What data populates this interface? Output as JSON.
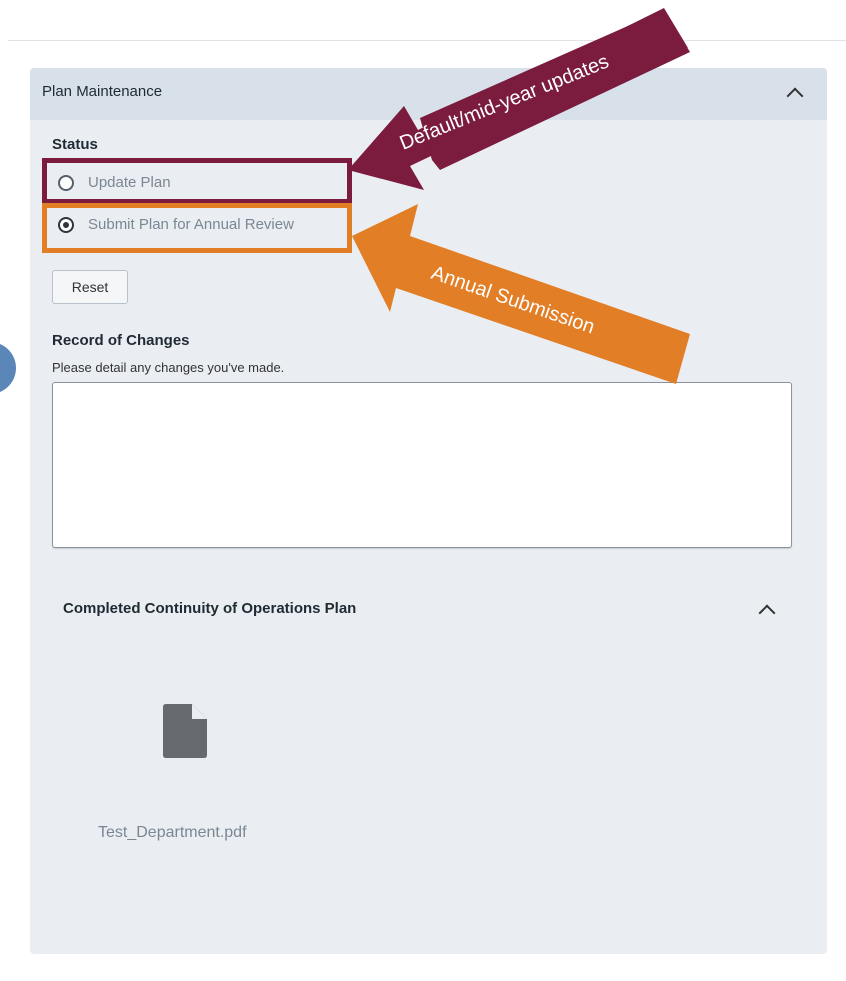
{
  "panel": {
    "title": "Plan Maintenance",
    "collapse_icon": "chevron-up-icon"
  },
  "status": {
    "label": "Status",
    "options": [
      {
        "label": "Update Plan",
        "selected": false
      },
      {
        "label": "Submit Plan for Annual Review",
        "selected": true
      }
    ],
    "reset_label": "Reset"
  },
  "record": {
    "title": "Record of Changes",
    "help": "Please detail any changes you've made.",
    "value": ""
  },
  "completed_plan": {
    "title": "Completed Continuity of Operations Plan",
    "collapse_icon": "chevron-up-icon",
    "file": {
      "icon": "file-icon",
      "name": "Test_Department.pdf"
    }
  },
  "annotations": {
    "update_callout": "Default/mid-year updates",
    "submit_callout": "Annual Submission",
    "colors": {
      "maroon": "#7b1b3e",
      "orange": "#e27e26"
    }
  }
}
